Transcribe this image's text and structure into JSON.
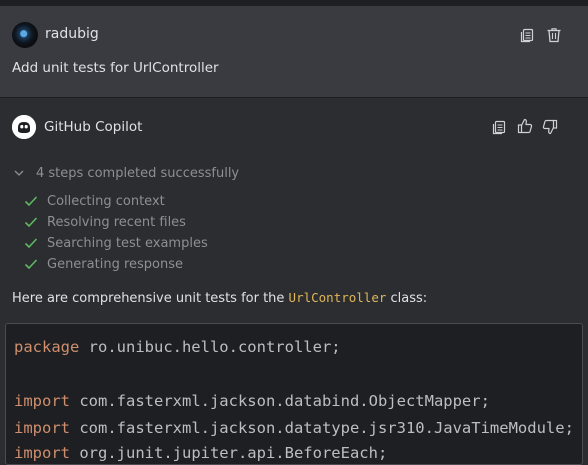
{
  "user": {
    "name": "radubig",
    "message": "Add unit tests for UrlController"
  },
  "assistant": {
    "name": "GitHub Copilot",
    "steps_header": "4 steps completed successfully",
    "steps": [
      "Collecting context",
      "Resolving recent files",
      "Searching test examples",
      "Generating response"
    ],
    "intro_before": "Here are comprehensive unit tests for the ",
    "intro_code": "UrlController",
    "intro_after": " class:"
  },
  "code": {
    "lines": [
      {
        "kw": "package",
        "rest": " ro.unibuc.hello.controller;"
      },
      {
        "kw": "",
        "rest": ""
      },
      {
        "kw": "import",
        "rest": " com.fasterxml.jackson.databind.ObjectMapper;"
      },
      {
        "kw": "import",
        "rest": " com.fasterxml.jackson.datatype.jsr310.JavaTimeModule;"
      },
      {
        "kw": "import",
        "rest": " org.junit.jupiter.api.BeforeEach;"
      }
    ]
  },
  "icons": {
    "copy": "copy-icon",
    "delete": "trash-icon",
    "thumbs_up": "thumbs-up-icon",
    "thumbs_down": "thumbs-down-icon",
    "check": "check-icon",
    "chevron": "chevron-down-icon"
  },
  "colors": {
    "background": "#2b2d30",
    "user_block": "#393b40",
    "code_bg": "#1e1f22",
    "keyword": "#cf8e6d",
    "inline_code": "#e0b65a",
    "check": "#5fb85f"
  }
}
